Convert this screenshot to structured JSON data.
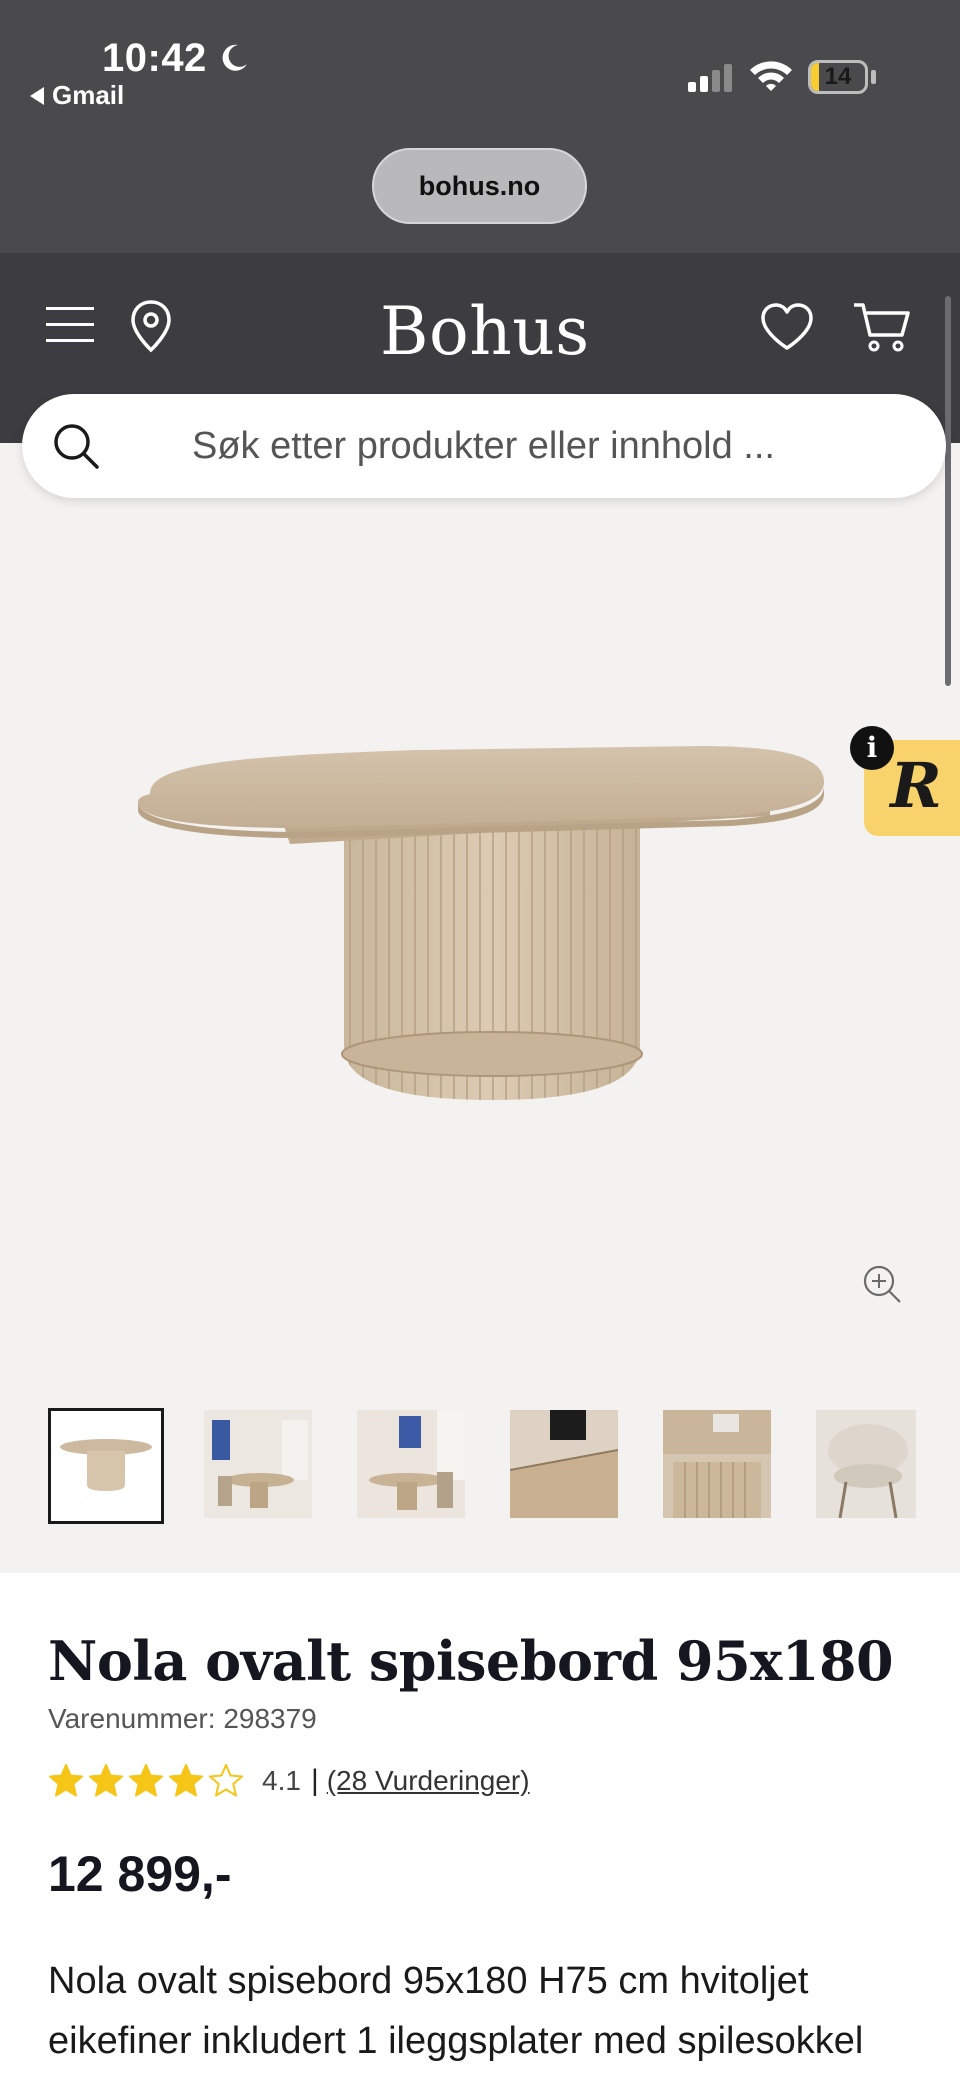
{
  "status_bar": {
    "time": "10:42",
    "back_app": "Gmail",
    "battery": "14",
    "battery_level": 0.14,
    "url": "bohus.no"
  },
  "header": {
    "logo": "Bohus",
    "icons": [
      "menu-icon",
      "location-pin-icon",
      "heart-icon",
      "cart-icon"
    ]
  },
  "search": {
    "placeholder": "Søk etter produkter eller innhold ..."
  },
  "gallery": {
    "thumbnail_count": 6,
    "active_index": 0
  },
  "product": {
    "title": "Nola ovalt spisebord 95x180",
    "sku_label": "Varenummer: 298379",
    "rating_value": "4.1",
    "rating_stars": 4.1,
    "rating_separator": "|",
    "rating_link": "(28 Vurderinger)",
    "price": "12 899,-",
    "description": "Nola ovalt spisebord 95x180 H75 cm hvitoljet eikefiner inkludert 1 ileggsplater med spilesokkel"
  },
  "colors": {
    "header_bg": "#3d3c40",
    "star": "#f5c518",
    "badge": "#f8d26a"
  }
}
